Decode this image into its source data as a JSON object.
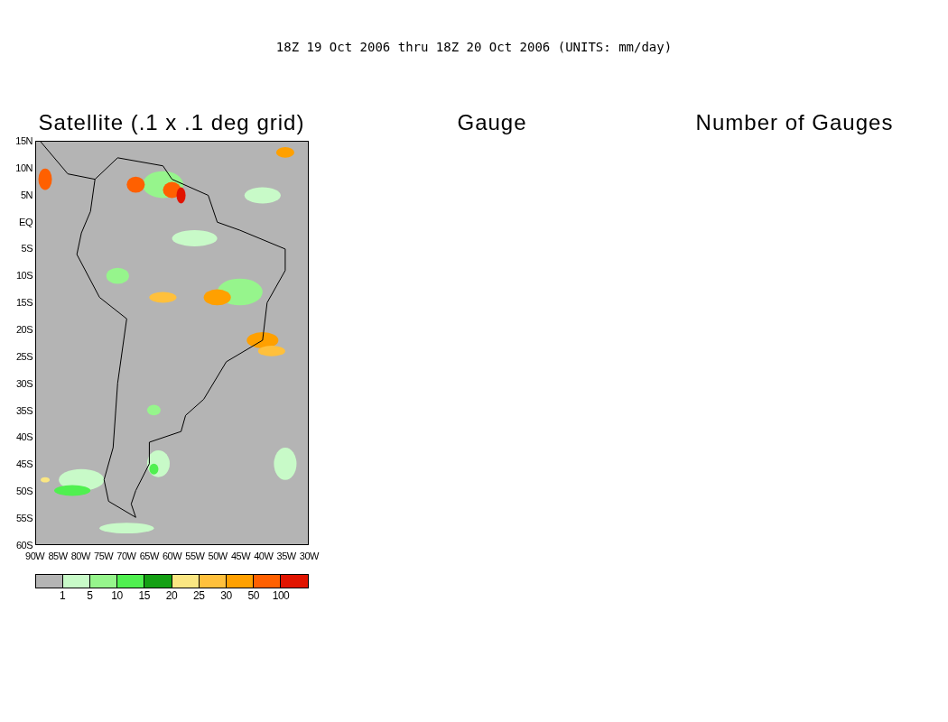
{
  "title": "18Z 19 Oct 2006 thru 18Z 20 Oct 2006 (UNITS: mm/day)",
  "panels": [
    {
      "kind": "map",
      "title": "Satellite (.1 x .1 deg grid)",
      "lat_ticks": [
        "15N",
        "10N",
        "5N",
        "EQ",
        "5S",
        "10S",
        "15S",
        "20S",
        "25S",
        "30S",
        "35S",
        "40S",
        "45S",
        "50S",
        "55S",
        "60S"
      ],
      "lon_ticks": [
        "90W",
        "85W",
        "80W",
        "75W",
        "70W",
        "65W",
        "60W",
        "55W",
        "50W",
        "45W",
        "40W",
        "35W",
        "30W"
      ],
      "legend": {
        "colors": [
          {
            "color": "#b4b4b4"
          },
          {
            "color": "#c8fac8"
          },
          {
            "color": "#96f58c"
          },
          {
            "color": "#50f050"
          },
          {
            "color": "#14a014"
          },
          {
            "color": "#fae682"
          },
          {
            "color": "#ffc03c"
          },
          {
            "color": "#ffa000"
          },
          {
            "color": "#ff6000"
          },
          {
            "color": "#e11400"
          }
        ],
        "labels": [
          "1",
          "5",
          "10",
          "15",
          "20",
          "25",
          "30",
          "50",
          "100"
        ]
      }
    },
    {
      "kind": "empty",
      "title": "Gauge"
    },
    {
      "kind": "empty",
      "title": "Number of Gauges"
    }
  ]
}
